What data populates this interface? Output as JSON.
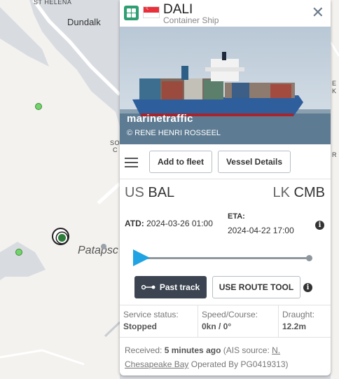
{
  "map": {
    "labels": {
      "st_helena": "ST HELENA",
      "dundalk": "Dundalk",
      "patapsco": "Patapsc",
      "right_edge_letters": [
        "E",
        "K",
        "R"
      ],
      "left_edge_letters": [
        "SO",
        "C"
      ]
    }
  },
  "vessel": {
    "name": "DALI",
    "type": "Container Ship",
    "flag_icon": "singapore-flag-icon",
    "type_icon": "container-ship-icon"
  },
  "photo": {
    "watermark": "marinetraffic",
    "copyright": "© RENE HENRI ROSSEEL"
  },
  "actions": {
    "add_to_fleet": "Add to fleet",
    "vessel_details": "Vessel Details"
  },
  "route": {
    "from_country": "US",
    "from_port": "BAL",
    "to_country": "LK",
    "to_port": "CMB",
    "atd_label": "ATD:",
    "atd_value": "2024-03-26 01:00",
    "eta_label": "ETA:",
    "eta_value": "2024-04-22 17:00",
    "progress_fraction": 0.0
  },
  "track": {
    "past_track": "Past track",
    "route_tool": "USE ROUTE TOOL"
  },
  "status": {
    "service_status_label": "Service status:",
    "service_status_value": "Stopped",
    "speed_course_label": "Speed/Course:",
    "speed_course_value": "0kn / 0°",
    "draught_label": "Draught:",
    "draught_value": "12.2m"
  },
  "received": {
    "label": "Received:",
    "time": "5 minutes ago",
    "ais_prefix": "(AIS source:",
    "ais_source": "N. Chesapeake Bay",
    "operated_by": "Operated By PG0419313)"
  },
  "colors": {
    "accent_blue": "#1fa3e2",
    "dark_button": "#3b4450",
    "ship_marker_green": "#2c7c3a",
    "type_icon_green": "#2f9e72"
  }
}
